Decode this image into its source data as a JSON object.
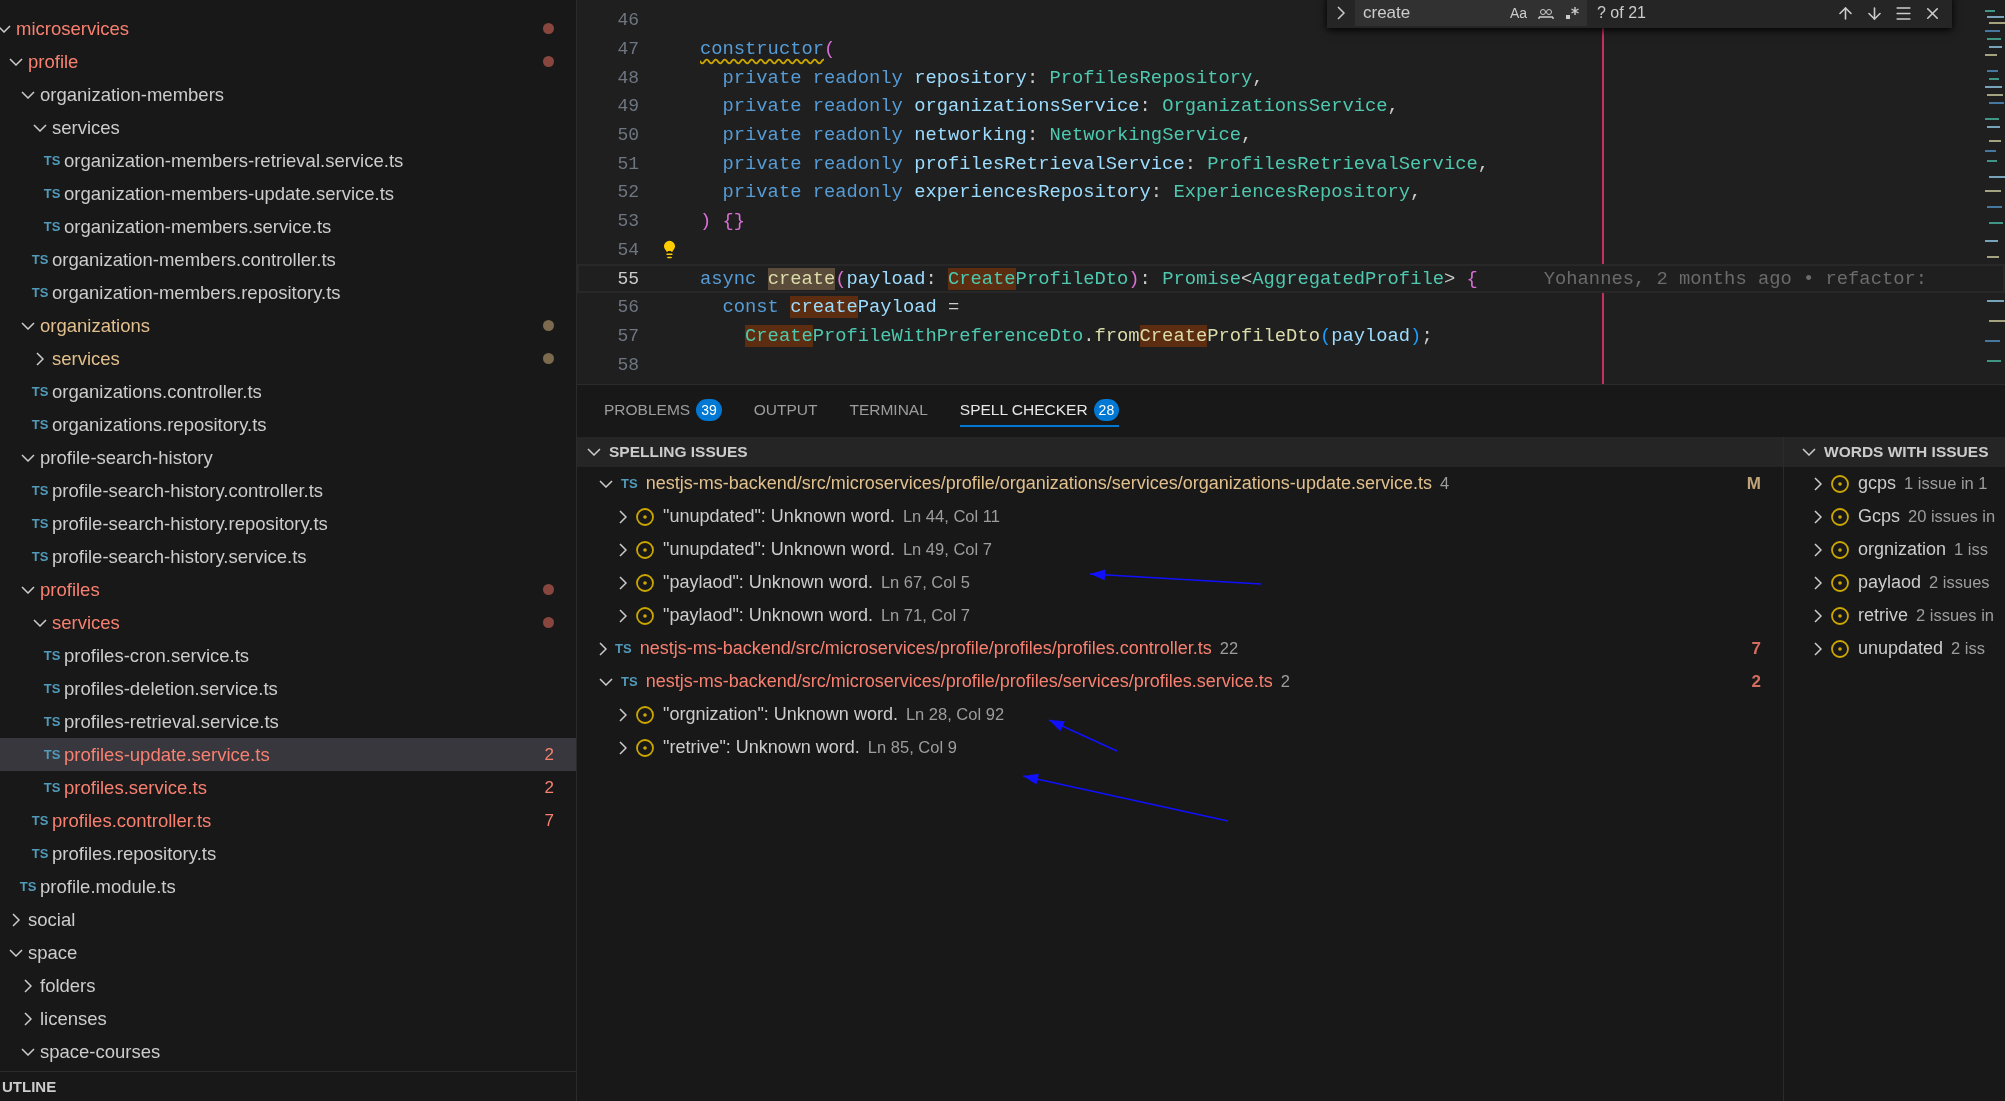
{
  "explorer": {
    "tree": [
      {
        "name": "microservices",
        "kind": "folder",
        "expanded": true,
        "color": "#f88070",
        "dot": true,
        "selected": false,
        "children": [
          {
            "name": "profile",
            "kind": "folder",
            "expanded": true,
            "color": "#f88070",
            "dot": true,
            "selected": false,
            "children": [
              {
                "name": "organization-members",
                "kind": "folder",
                "expanded": true,
                "color": "#cccccc",
                "dot": false,
                "selected": false,
                "children": [
                  {
                    "name": "services",
                    "kind": "folder",
                    "expanded": true,
                    "color": "#cccccc",
                    "dot": false,
                    "selected": false,
                    "children": [
                      {
                        "name": "organization-members-retrieval.service.ts",
                        "kind": "file",
                        "icon_text": "TS",
                        "color": "#cccccc",
                        "dot": false,
                        "selected": false
                      },
                      {
                        "name": "organization-members-update.service.ts",
                        "kind": "file",
                        "icon_text": "TS",
                        "color": "#cccccc",
                        "dot": false,
                        "selected": false
                      },
                      {
                        "name": "organization-members.service.ts",
                        "kind": "file",
                        "icon_text": "TS",
                        "color": "#cccccc",
                        "dot": false,
                        "selected": false
                      }
                    ]
                  },
                  {
                    "name": "organization-members.controller.ts",
                    "kind": "file",
                    "icon_text": "TS",
                    "color": "#cccccc",
                    "dot": false,
                    "selected": false
                  },
                  {
                    "name": "organization-members.repository.ts",
                    "kind": "file",
                    "icon_text": "TS",
                    "color": "#cccccc",
                    "dot": false,
                    "selected": false
                  }
                ]
              },
              {
                "name": "organizations",
                "kind": "folder",
                "expanded": true,
                "color": "#e2c08d",
                "dot": true,
                "selected": false,
                "children": [
                  {
                    "name": "services",
                    "kind": "folder",
                    "expanded": false,
                    "color": "#e2c08d",
                    "dot": true,
                    "selected": false
                  },
                  {
                    "name": "organizations.controller.ts",
                    "kind": "file",
                    "icon_text": "TS",
                    "color": "#cccccc",
                    "dot": false,
                    "selected": false
                  },
                  {
                    "name": "organizations.repository.ts",
                    "kind": "file",
                    "icon_text": "TS",
                    "color": "#cccccc",
                    "dot": false,
                    "selected": false
                  }
                ]
              },
              {
                "name": "profile-search-history",
                "kind": "folder",
                "expanded": true,
                "color": "#cccccc",
                "dot": false,
                "selected": false,
                "children": [
                  {
                    "name": "profile-search-history.controller.ts",
                    "kind": "file",
                    "icon_text": "TS",
                    "color": "#cccccc",
                    "dot": false,
                    "selected": false
                  },
                  {
                    "name": "profile-search-history.repository.ts",
                    "kind": "file",
                    "icon_text": "TS",
                    "color": "#cccccc",
                    "dot": false,
                    "selected": false
                  },
                  {
                    "name": "profile-search-history.service.ts",
                    "kind": "file",
                    "icon_text": "TS",
                    "color": "#cccccc",
                    "dot": false,
                    "selected": false
                  }
                ]
              },
              {
                "name": "profiles",
                "kind": "folder",
                "expanded": true,
                "color": "#f88070",
                "dot": true,
                "selected": false,
                "children": [
                  {
                    "name": "services",
                    "kind": "folder",
                    "expanded": true,
                    "color": "#f88070",
                    "dot": true,
                    "selected": false,
                    "children": [
                      {
                        "name": "profiles-cron.service.ts",
                        "kind": "file",
                        "icon_text": "TS",
                        "color": "#cccccc",
                        "dot": false,
                        "selected": false
                      },
                      {
                        "name": "profiles-deletion.service.ts",
                        "kind": "file",
                        "icon_text": "TS",
                        "color": "#cccccc",
                        "dot": false,
                        "selected": false
                      },
                      {
                        "name": "profiles-retrieval.service.ts",
                        "kind": "file",
                        "icon_text": "TS",
                        "color": "#cccccc",
                        "dot": false,
                        "selected": false
                      },
                      {
                        "name": "profiles-update.service.ts",
                        "kind": "file",
                        "icon_text": "TS",
                        "color": "#f88070",
                        "dot": false,
                        "selected": true,
                        "count": "2"
                      },
                      {
                        "name": "profiles.service.ts",
                        "kind": "file",
                        "icon_text": "TS",
                        "color": "#f88070",
                        "dot": false,
                        "selected": false,
                        "count": "2"
                      }
                    ]
                  },
                  {
                    "name": "profiles.controller.ts",
                    "kind": "file",
                    "icon_text": "TS",
                    "color": "#f88070",
                    "dot": false,
                    "selected": false,
                    "count": "7"
                  },
                  {
                    "name": "profiles.repository.ts",
                    "kind": "file",
                    "icon_text": "TS",
                    "color": "#cccccc",
                    "dot": false,
                    "selected": false
                  }
                ]
              },
              {
                "name": "profile.module.ts",
                "kind": "file",
                "icon_text": "TS",
                "color": "#cccccc",
                "dot": false,
                "selected": false
              }
            ]
          },
          {
            "name": "social",
            "kind": "folder",
            "expanded": false,
            "color": "#cccccc",
            "dot": false,
            "selected": false
          },
          {
            "name": "space",
            "kind": "folder",
            "expanded": true,
            "color": "#cccccc",
            "dot": false,
            "selected": false,
            "children": [
              {
                "name": "folders",
                "kind": "folder",
                "expanded": false,
                "color": "#cccccc",
                "dot": false,
                "selected": false
              },
              {
                "name": "licenses",
                "kind": "folder",
                "expanded": false,
                "color": "#cccccc",
                "dot": false,
                "selected": false
              },
              {
                "name": "space-courses",
                "kind": "folder",
                "expanded": true,
                "color": "#cccccc",
                "dot": false,
                "selected": false
              }
            ]
          }
        ]
      }
    ],
    "outline_header": "UTLINE"
  },
  "editor": {
    "find": {
      "value": "create",
      "match_case": "Aa",
      "result": "? of 21"
    },
    "lines": [
      {
        "number": "46",
        "current": false
      },
      {
        "number": "47",
        "current": false,
        "tokens": [
          {
            "text": "constructor",
            "kind": "kw",
            "squiggle": true
          },
          {
            "text": "(",
            "kind": "b1",
            "squiggle": false
          }
        ]
      },
      {
        "number": "48",
        "current": false,
        "tokens": [
          {
            "text": "  private readonly ",
            "kind": "kw"
          },
          {
            "text": "repository",
            "kind": "var"
          },
          {
            "text": ": ",
            "kind": "punct"
          },
          {
            "text": "ProfilesRepository",
            "kind": "type"
          },
          {
            "text": ",",
            "kind": "punct"
          }
        ]
      },
      {
        "number": "49",
        "current": false,
        "tokens": [
          {
            "text": "  private readonly ",
            "kind": "kw"
          },
          {
            "text": "organizationsService",
            "kind": "var"
          },
          {
            "text": ": ",
            "kind": "punct"
          },
          {
            "text": "OrganizationsService",
            "kind": "type"
          },
          {
            "text": ",",
            "kind": "punct"
          }
        ]
      },
      {
        "number": "50",
        "current": false,
        "tokens": [
          {
            "text": "  private readonly ",
            "kind": "kw"
          },
          {
            "text": "networking",
            "kind": "var"
          },
          {
            "text": ": ",
            "kind": "punct"
          },
          {
            "text": "NetworkingService",
            "kind": "type"
          },
          {
            "text": ",",
            "kind": "punct"
          }
        ]
      },
      {
        "number": "51",
        "current": false,
        "tokens": [
          {
            "text": "  private readonly ",
            "kind": "kw"
          },
          {
            "text": "profilesRetrievalService",
            "kind": "var"
          },
          {
            "text": ": ",
            "kind": "punct"
          },
          {
            "text": "ProfilesRetrievalService",
            "kind": "type"
          },
          {
            "text": ",",
            "kind": "punct"
          }
        ]
      },
      {
        "number": "52",
        "current": false,
        "tokens": [
          {
            "text": "  private readonly ",
            "kind": "kw"
          },
          {
            "text": "experiencesRepository",
            "kind": "var"
          },
          {
            "text": ": ",
            "kind": "punct"
          },
          {
            "text": "ExperiencesRepository",
            "kind": "type"
          },
          {
            "text": ",",
            "kind": "punct"
          }
        ]
      },
      {
        "number": "53",
        "current": false,
        "tokens": [
          {
            "text": ")",
            "kind": "b1"
          },
          {
            "text": " {}",
            "kind": "b1"
          }
        ]
      },
      {
        "number": "54",
        "current": false,
        "lightbulb": true
      },
      {
        "number": "55",
        "current": true,
        "tokens": [
          {
            "text": "async ",
            "kind": "kw"
          },
          {
            "text": "create",
            "kind": "func",
            "match": true,
            "current_match": true
          },
          {
            "text": "(",
            "kind": "b1"
          },
          {
            "text": "payload",
            "kind": "var"
          },
          {
            "text": ": ",
            "kind": "punct"
          },
          {
            "text": "Create",
            "kind": "type",
            "match": true,
            "current_match": false
          },
          {
            "text": "ProfileDto",
            "kind": "type"
          },
          {
            "text": ")",
            "kind": "b1"
          },
          {
            "text": ": ",
            "kind": "punct"
          },
          {
            "text": "Promise",
            "kind": "type"
          },
          {
            "text": "<",
            "kind": "punct"
          },
          {
            "text": "AggregatedProfile",
            "kind": "type"
          },
          {
            "text": ">",
            "kind": "punct"
          },
          {
            "text": " {",
            "kind": "b1"
          }
        ],
        "blame": "Yohannes, 2 months ago • refactor:"
      },
      {
        "number": "56",
        "current": false,
        "tokens": [
          {
            "text": "  const ",
            "kind": "kw"
          },
          {
            "text": "create",
            "kind": "var",
            "match": true,
            "current_match": false
          },
          {
            "text": "Payload",
            "kind": "var"
          },
          {
            "text": " =",
            "kind": "punct"
          }
        ]
      },
      {
        "number": "57",
        "current": false,
        "indented": true,
        "tokens": [
          {
            "text": "Create",
            "kind": "type",
            "match": true,
            "current_match": false
          },
          {
            "text": "ProfileWithPreferenceDto",
            "kind": "type"
          },
          {
            "text": ".",
            "kind": "punct"
          },
          {
            "text": "from",
            "kind": "func"
          },
          {
            "text": "Create",
            "kind": "func",
            "match": true,
            "current_match": false
          },
          {
            "text": "ProfileDto",
            "kind": "func"
          },
          {
            "text": "(",
            "kind": "b2"
          },
          {
            "text": "payload",
            "kind": "var"
          },
          {
            "text": ")",
            "kind": "b2"
          },
          {
            "text": ";",
            "kind": "punct"
          }
        ]
      },
      {
        "number": "58",
        "current": false
      }
    ]
  },
  "panel": {
    "tabs": [
      {
        "label": "PROBLEMS",
        "badge": "39",
        "selected": false
      },
      {
        "label": "OUTPUT",
        "selected": false
      },
      {
        "label": "TERMINAL",
        "selected": false
      },
      {
        "label": "SPELL CHECKER",
        "badge": "28",
        "selected": true
      }
    ],
    "spelling_issues": {
      "title": "SPELLING ISSUES",
      "expanded": true,
      "files": [
        {
          "icon_text": "TS",
          "path": "nestjs-ms-backend/src/microservices/profile/organizations/services/organizations-update.service.ts",
          "count": "4",
          "color": "#e2c08d",
          "status_letter": "M",
          "expanded": true,
          "issues": [
            {
              "message": "\"unupdated\": Unknown word.",
              "location": "Ln 44, Col 11"
            },
            {
              "message": "\"unupdated\": Unknown word.",
              "location": "Ln 49, Col 7"
            },
            {
              "message": "\"paylaod\": Unknown word.",
              "location": "Ln 67, Col 5"
            },
            {
              "message": "\"paylaod\": Unknown word.",
              "location": "Ln 71, Col 7"
            }
          ]
        },
        {
          "icon_text": "TS",
          "path": "nestjs-ms-backend/src/microservices/profile/profiles/profiles.controller.ts",
          "count": "22",
          "color": "#f88070",
          "status_letter": "7",
          "expanded": false
        },
        {
          "icon_text": "TS",
          "path": "nestjs-ms-backend/src/microservices/profile/profiles/services/profiles.service.ts",
          "count": "2",
          "color": "#f88070",
          "status_letter": "2",
          "expanded": true,
          "issues": [
            {
              "message": "\"orgnization\": Unknown word.",
              "location": "Ln 28, Col 92"
            },
            {
              "message": "\"retrive\": Unknown word.",
              "location": "Ln 85, Col 9"
            }
          ]
        }
      ]
    },
    "words": {
      "title": "WORDS WITH ISSUES",
      "expanded": true,
      "items": [
        {
          "word": "gcps",
          "detail": "1 issue in 1"
        },
        {
          "word": "Gcps",
          "detail": "20 issues in"
        },
        {
          "word": "orgnization",
          "detail": "1 iss"
        },
        {
          "word": "paylaod",
          "detail": "2 issues"
        },
        {
          "word": "retrive",
          "detail": "2 issues in"
        },
        {
          "word": "unupdated",
          "detail": "2 iss"
        }
      ]
    }
  }
}
